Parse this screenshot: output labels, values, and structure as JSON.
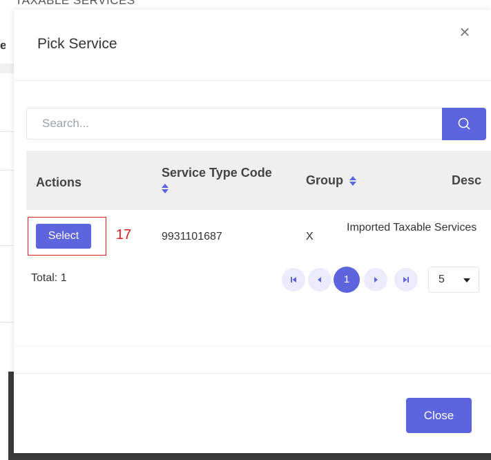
{
  "background": {
    "heading": "TAXABLE SERVICES",
    "side_letter": "e"
  },
  "modal": {
    "title": "Pick Service",
    "close_glyph": "×",
    "search": {
      "placeholder": "Search...",
      "icon": "search-icon"
    },
    "table": {
      "columns": [
        "Actions",
        "Service Type Code",
        "Group",
        "Desc"
      ],
      "rows": [
        {
          "action_label": "Select",
          "service_type_code": "9931101687",
          "group": "X",
          "description": "Imported Taxable Services"
        }
      ]
    },
    "annotation": {
      "number": "17",
      "color": "#e21b1b"
    },
    "total_label": "Total: 1",
    "pagination": {
      "first_icon": "first-page-icon",
      "prev_icon": "prev-page-icon",
      "current_page": "1",
      "next_icon": "next-page-icon",
      "last_icon": "last-page-icon",
      "page_size": "5"
    },
    "close_button_label": "Close"
  },
  "colors": {
    "accent": "#5d65de",
    "accent_light": "#ecebfb",
    "header_bg": "#efefef"
  }
}
